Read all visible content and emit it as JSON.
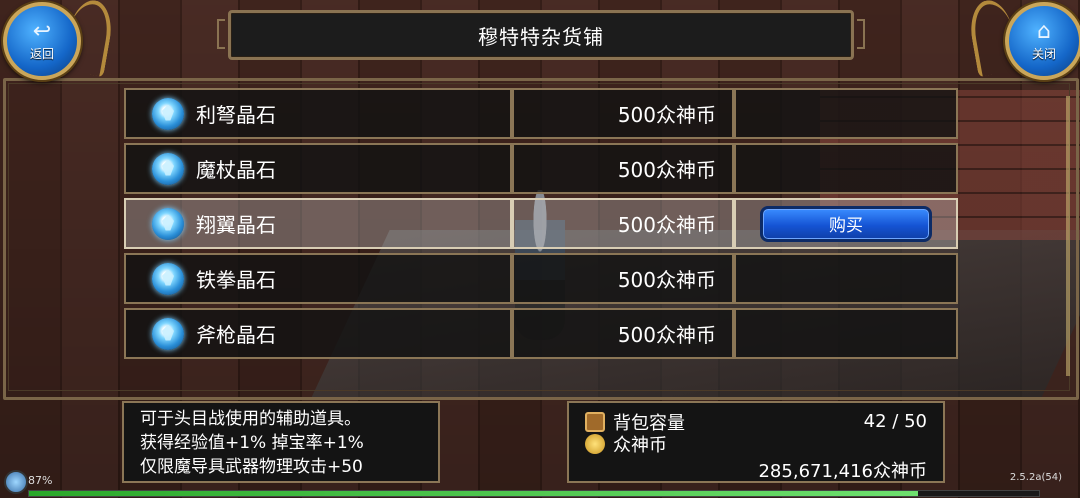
{
  "header": {
    "title": "穆特特杂货铺",
    "back_label": "返回",
    "close_label": "关闭"
  },
  "items": [
    {
      "name": "利弩晶石",
      "price": "500众神币",
      "selected": false
    },
    {
      "name": "魔杖晶石",
      "price": "500众神币",
      "selected": false
    },
    {
      "name": "翔翼晶石",
      "price": "500众神币",
      "selected": true
    },
    {
      "name": "铁拳晶石",
      "price": "500众神币",
      "selected": false
    },
    {
      "name": "斧枪晶石",
      "price": "500众神币",
      "selected": false
    }
  ],
  "buy_label": "购买",
  "description": {
    "line1": "可于头目战使用的辅助道具。",
    "line2": "获得经验值+1% 掉宝率+1%",
    "line3": "仅限魔导具武器物理攻击+50"
  },
  "inventory": {
    "bag_label": "背包容量",
    "bag_value": "42 / 50",
    "currency_label": "众神币",
    "currency_value": "285,671,416众神币"
  },
  "status": {
    "battery": "87%",
    "version": "2.5.2a(54)",
    "xp_progress": 0.88
  },
  "icons": {
    "back": "back-arrow-icon",
    "close": "home-icon",
    "item": "crystal-icon",
    "bag": "bag-icon",
    "coin": "coin-icon"
  }
}
